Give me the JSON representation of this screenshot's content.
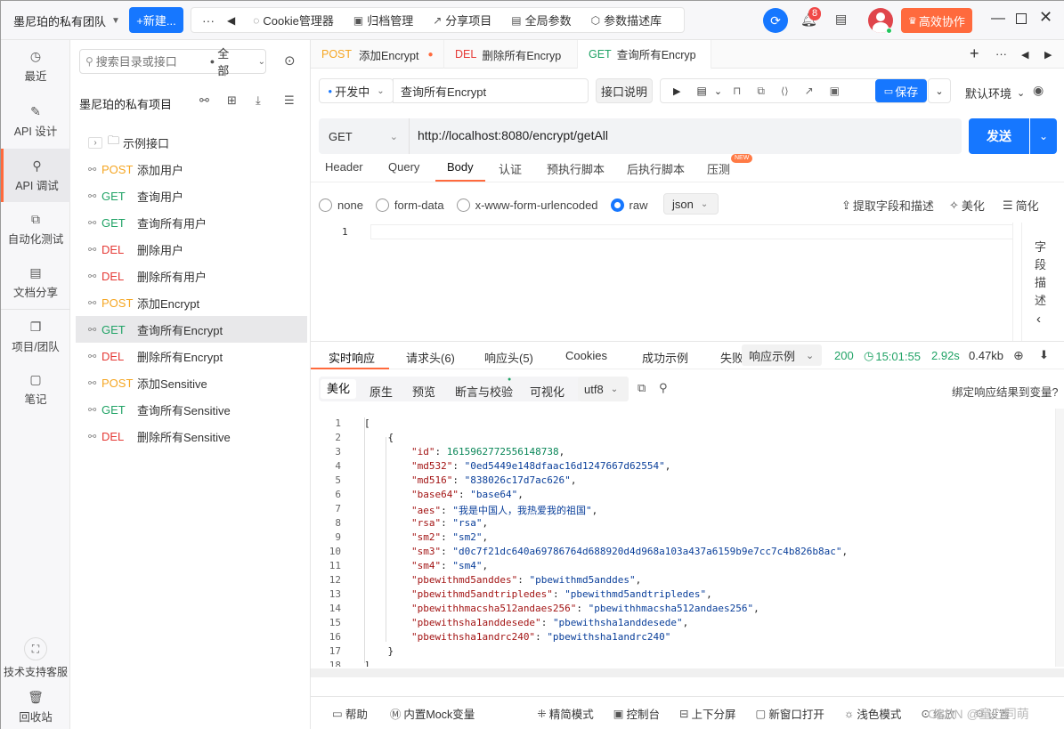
{
  "titlebar": {
    "team": "墨尼珀的私有团队",
    "new_button": "+新建...",
    "more": "···",
    "toolbar": [
      {
        "icon": "cookie-icon",
        "label": "Cookie管理器"
      },
      {
        "icon": "archive-icon",
        "label": "归档管理"
      },
      {
        "icon": "share-icon",
        "label": "分享项目"
      },
      {
        "icon": "globe-icon",
        "label": "全局参数"
      },
      {
        "icon": "cube-icon",
        "label": "参数描述库"
      }
    ],
    "notification_count": "8",
    "upgrade": "高效协作"
  },
  "rail": [
    {
      "icon": "history-icon",
      "label": "最近"
    },
    {
      "icon": "edit-icon",
      "label": "API 设计"
    },
    {
      "icon": "debug-icon",
      "label": "API 调试"
    },
    {
      "icon": "automation-icon",
      "label": "自动化测试"
    },
    {
      "icon": "doc-icon",
      "label": "文档分享"
    },
    {
      "icon": "project-icon",
      "label": "项目/团队"
    },
    {
      "icon": "note-icon",
      "label": "笔记"
    },
    {
      "icon": "support-icon",
      "label": "技术支持客服"
    },
    {
      "icon": "trash-icon",
      "label": "回收站"
    }
  ],
  "tree": {
    "search_placeholder": "搜索目录或接口",
    "filter": "全部",
    "project": "墨尼珀的私有项目",
    "folder": "示例接口",
    "items": [
      {
        "method": "POST",
        "name": "添加用户"
      },
      {
        "method": "GET",
        "name": "查询用户"
      },
      {
        "method": "GET",
        "name": "查询所有用户"
      },
      {
        "method": "DEL",
        "name": "删除用户"
      },
      {
        "method": "DEL",
        "name": "删除所有用户"
      },
      {
        "method": "POST",
        "name": "添加Encrypt"
      },
      {
        "method": "GET",
        "name": "查询所有Encrypt"
      },
      {
        "method": "DEL",
        "name": "删除所有Encrypt"
      },
      {
        "method": "POST",
        "name": "添加Sensitive"
      },
      {
        "method": "GET",
        "name": "查询所有Sensitive"
      },
      {
        "method": "DEL",
        "name": "删除所有Sensitive"
      }
    ]
  },
  "tabs": [
    {
      "method": "POST",
      "name": "添加Encrypt"
    },
    {
      "method": "DEL",
      "name": "删除所有Encryp"
    },
    {
      "method": "GET",
      "name": "查询所有Encryp"
    }
  ],
  "request": {
    "status": "开发中",
    "name": "查询所有Encrypt",
    "doc_button": "接口说明",
    "save": "保存",
    "env": "默认环境",
    "method": "GET",
    "url": "http://localhost:8080/encrypt/getAll",
    "send": "发送",
    "subtabs": [
      "Header",
      "Query",
      "Body",
      "认证",
      "预执行脚本",
      "后执行脚本",
      "压测"
    ],
    "new_badge": "NEW",
    "body_types": [
      "none",
      "form-data",
      "x-www-form-urlencoded",
      "raw"
    ],
    "raw_format": "json",
    "extract": "提取字段和描述",
    "beautify": "美化",
    "simplify": "简化",
    "field_desc": "字段描述",
    "line1": "1"
  },
  "response": {
    "tabs": [
      "实时响应",
      "请求头(6)",
      "响应头(5)",
      "Cookies",
      "成功示例",
      "失败"
    ],
    "example": "响应示例",
    "status": "200",
    "time": "15:01:55",
    "duration": "2.92s",
    "size": "0.47kb",
    "views": [
      "美化",
      "原生",
      "预览",
      "断言与校验",
      "可视化"
    ],
    "encoding": "utf8",
    "bind": "绑定响应结果到变量?",
    "lines": [
      "[",
      "    {",
      "        \"id\": 1615962772556148738,",
      "        \"md532\": \"0ed5449e148dfaac16d1247667d62554\",",
      "        \"md516\": \"838026c17d7ac626\",",
      "        \"base64\": \"base64\",",
      "        \"aes\": \"我是中国人，我热爱我的祖国\",",
      "        \"rsa\": \"rsa\",",
      "        \"sm2\": \"sm2\",",
      "        \"sm3\": \"d0c7f21dc640a69786764d688920d4d968a103a437a6159b9e7cc7c4b826b8ac\",",
      "        \"sm4\": \"sm4\",",
      "        \"pbewithmd5anddes\": \"pbewithmd5anddes\",",
      "        \"pbewithmd5andtripledes\": \"pbewithmd5andtripledes\",",
      "        \"pbewithhmacsha512andaes256\": \"pbewithhmacsha512andaes256\",",
      "        \"pbewithsha1anddesede\": \"pbewithsha1anddesede\",",
      "        \"pbewithsha1andrc240\": \"pbewithsha1andrc240\"",
      "    }",
      "]"
    ]
  },
  "footer": [
    {
      "icon": "help-icon",
      "label": "帮助"
    },
    {
      "icon": "mock-icon",
      "label": "内置Mock变量"
    },
    {
      "icon": "layout-icon",
      "label": "精简模式"
    },
    {
      "icon": "console-icon",
      "label": "控制台"
    },
    {
      "icon": "split-icon",
      "label": "上下分屏"
    },
    {
      "icon": "window-icon",
      "label": "新窗口打开"
    },
    {
      "icon": "sun-icon",
      "label": "浅色模式"
    },
    {
      "icon": "zoom-icon",
      "label": "缩放"
    },
    {
      "icon": "settings-icon",
      "label": "设置"
    }
  ],
  "watermark": "CSDN @童心同萌",
  "colors": {
    "primary": "#1677ff",
    "accent": "#ff6a3d",
    "post": "#f5a623",
    "get": "#21a366",
    "del": "#e53935"
  }
}
